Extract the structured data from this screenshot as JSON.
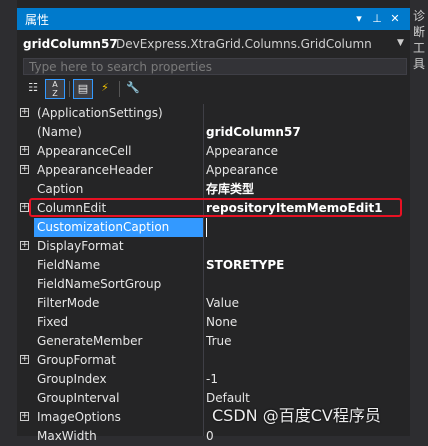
{
  "side_tab": {
    "chars": [
      "诊",
      "断",
      "工",
      "具"
    ]
  },
  "panel": {
    "title": "属性",
    "buttons": {
      "dropdown": "▾",
      "pin": "⊥",
      "close": "✕"
    }
  },
  "object": {
    "name": "gridColumn57",
    "type": "DevExpress.XtraGrid.Columns.GridColumn"
  },
  "search": {
    "placeholder": "Type here to search properties",
    "value": ""
  },
  "toolbar": {
    "tools": [
      {
        "icon": "categorized-icon",
        "glyph": "☷"
      },
      {
        "icon": "alphabetical-icon",
        "glyph": "AZ"
      },
      {
        "icon": "properties-icon",
        "glyph": "▤"
      },
      {
        "icon": "events-icon",
        "glyph": "⚡"
      },
      {
        "icon": "property-pages-icon",
        "glyph": "🔧"
      }
    ]
  },
  "properties": [
    {
      "name": "(ApplicationSettings)",
      "value": "",
      "expandable": true,
      "bold": false
    },
    {
      "name": "(Name)",
      "value": "gridColumn57",
      "expandable": false,
      "bold": true
    },
    {
      "name": "AppearanceCell",
      "value": "Appearance",
      "expandable": true,
      "bold": false
    },
    {
      "name": "AppearanceHeader",
      "value": "Appearance",
      "expandable": true,
      "bold": false
    },
    {
      "name": "Caption",
      "value": "存库类型",
      "expandable": false,
      "bold": true
    },
    {
      "name": "ColumnEdit",
      "value": "repositoryItemMemoEdit1",
      "expandable": true,
      "bold": true
    },
    {
      "name": "CustomizationCaption",
      "value": "",
      "expandable": false,
      "bold": false,
      "selected": true
    },
    {
      "name": "DisplayFormat",
      "value": "",
      "expandable": true,
      "bold": false
    },
    {
      "name": "FieldName",
      "value": "STORETYPE",
      "expandable": false,
      "bold": true
    },
    {
      "name": "FieldNameSortGroup",
      "value": "",
      "expandable": false,
      "bold": false
    },
    {
      "name": "FilterMode",
      "value": "Value",
      "expandable": false,
      "bold": false
    },
    {
      "name": "Fixed",
      "value": "None",
      "expandable": false,
      "bold": false
    },
    {
      "name": "GenerateMember",
      "value": "True",
      "expandable": false,
      "bold": false
    },
    {
      "name": "GroupFormat",
      "value": "",
      "expandable": true,
      "bold": false
    },
    {
      "name": "GroupIndex",
      "value": "-1",
      "expandable": false,
      "bold": false
    },
    {
      "name": "GroupInterval",
      "value": "Default",
      "expandable": false,
      "bold": false
    },
    {
      "name": "ImageOptions",
      "value": "",
      "expandable": true,
      "bold": false
    },
    {
      "name": "MaxWidth",
      "value": "0",
      "expandable": false,
      "bold": false
    }
  ],
  "watermark": "CSDN @百度CV程序员",
  "colors": {
    "accent": "#007acc",
    "selection": "#3399ff",
    "highlight_box": "#e81123",
    "background": "#252526"
  }
}
